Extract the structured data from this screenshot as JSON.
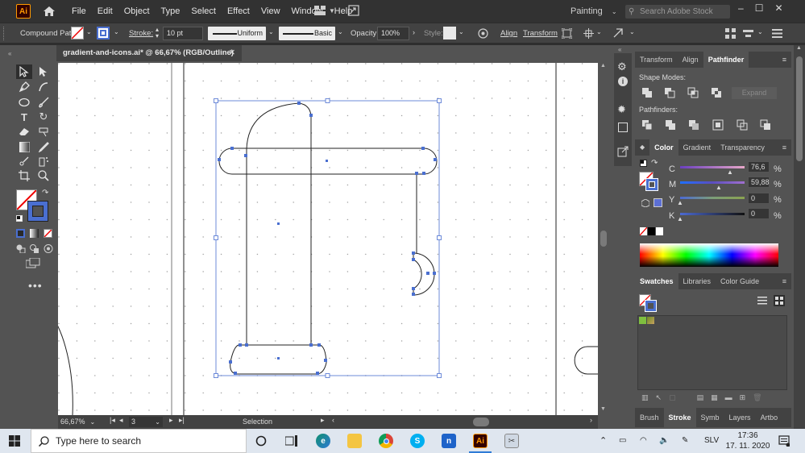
{
  "menubar": {
    "logo": "Ai",
    "items": [
      "File",
      "Edit",
      "Object",
      "Type",
      "Select",
      "Effect",
      "View",
      "Window",
      "Help"
    ],
    "workspace": "Painting",
    "search_placeholder": "Search Adobe Stock"
  },
  "controlbar": {
    "object_type": "Compound Path",
    "stroke_label": "Stroke:",
    "stroke_value": "10 pt",
    "stroke_profile": "Uniform",
    "brush": "Basic",
    "opacity_label": "Opacity:",
    "opacity_value": "100%",
    "style_label": "Style:",
    "align_label": "Align",
    "transform_label": "Transform"
  },
  "document": {
    "tab_title": "gradient-and-icons.ai* @ 66,67% (RGB/Outline)",
    "zoom": "66,67%",
    "artboard": "3",
    "status": "Selection"
  },
  "panels": {
    "top_tabs": [
      "Transform",
      "Align",
      "Pathfinder"
    ],
    "active_top_tab": "Pathfinder",
    "shape_modes_label": "Shape Modes:",
    "expand_label": "Expand",
    "pathfinders_label": "Pathfinders:",
    "color_tabs": [
      "Color",
      "Gradient",
      "Transparency"
    ],
    "cmyk": [
      {
        "channel": "C",
        "value": "76,6",
        "pct": 76.6
      },
      {
        "channel": "M",
        "value": "59,88",
        "pct": 59.88
      },
      {
        "channel": "Y",
        "value": "0",
        "pct": 0
      },
      {
        "channel": "K",
        "value": "0",
        "pct": 0
      }
    ],
    "percent_sign": "%",
    "swatch_tabs": [
      "Swatches",
      "Libraries",
      "Color Guide"
    ],
    "bottom_tabs": [
      "Brush",
      "Stroke",
      "Symb",
      "Layers",
      "Artbo"
    ]
  },
  "taskbar": {
    "search_placeholder": "Type here to search",
    "language": "SLV",
    "time": "17:36",
    "date": "17. 11. 2020"
  },
  "colors": {
    "selection": "#4a6fd0",
    "ui_dark": "#323232",
    "ui_mid": "#424242",
    "ui_panel": "#535353",
    "ai_orange": "#ff9a00"
  }
}
